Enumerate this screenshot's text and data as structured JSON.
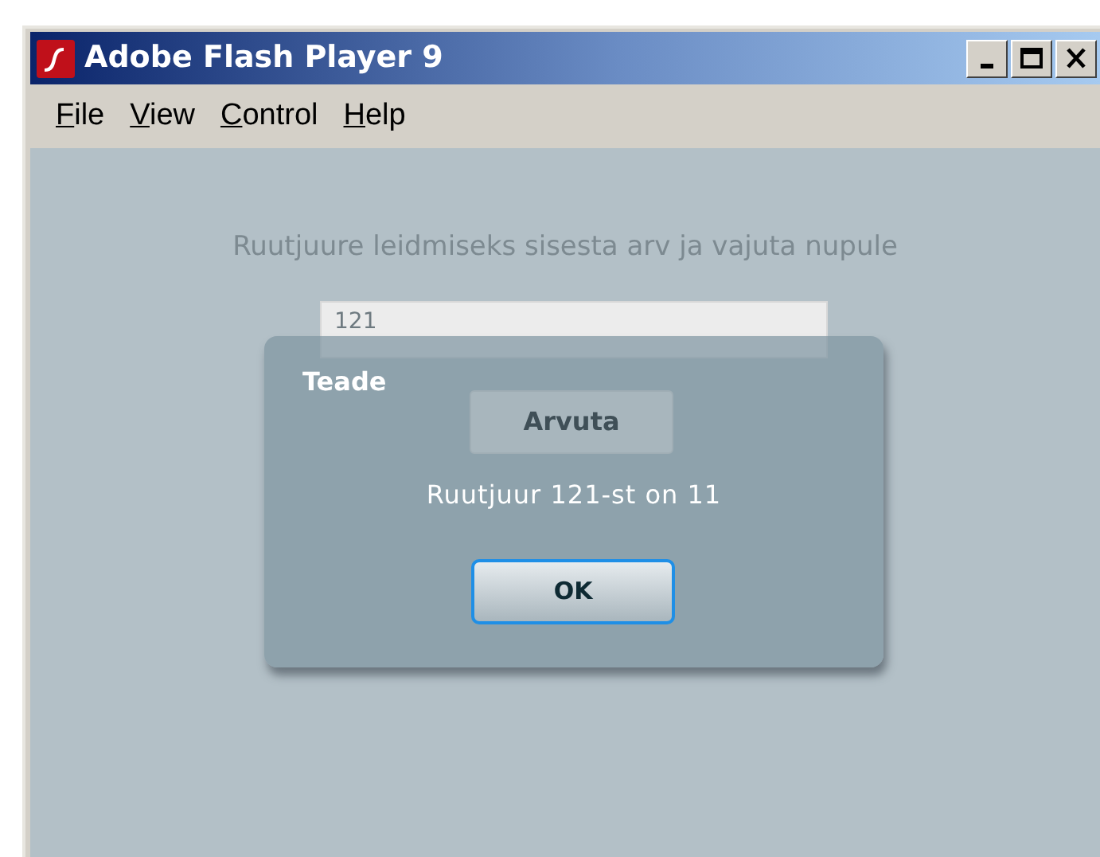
{
  "window": {
    "title": "Adobe Flash Player 9"
  },
  "menu": [
    {
      "label": "File",
      "mnemonic": true
    },
    {
      "label": "View",
      "mnemonic": true
    },
    {
      "label": "Control",
      "mnemonic": true
    },
    {
      "label": "Help",
      "mnemonic": true
    }
  ],
  "app": {
    "instruction": "Ruutjuure leidmiseks sisesta arv ja vajuta nupule",
    "input_value": "121",
    "button": "Arvuta"
  },
  "dialog": {
    "title": "Teade",
    "message": "Ruutjuur 121-st on 11",
    "button": "OK"
  }
}
